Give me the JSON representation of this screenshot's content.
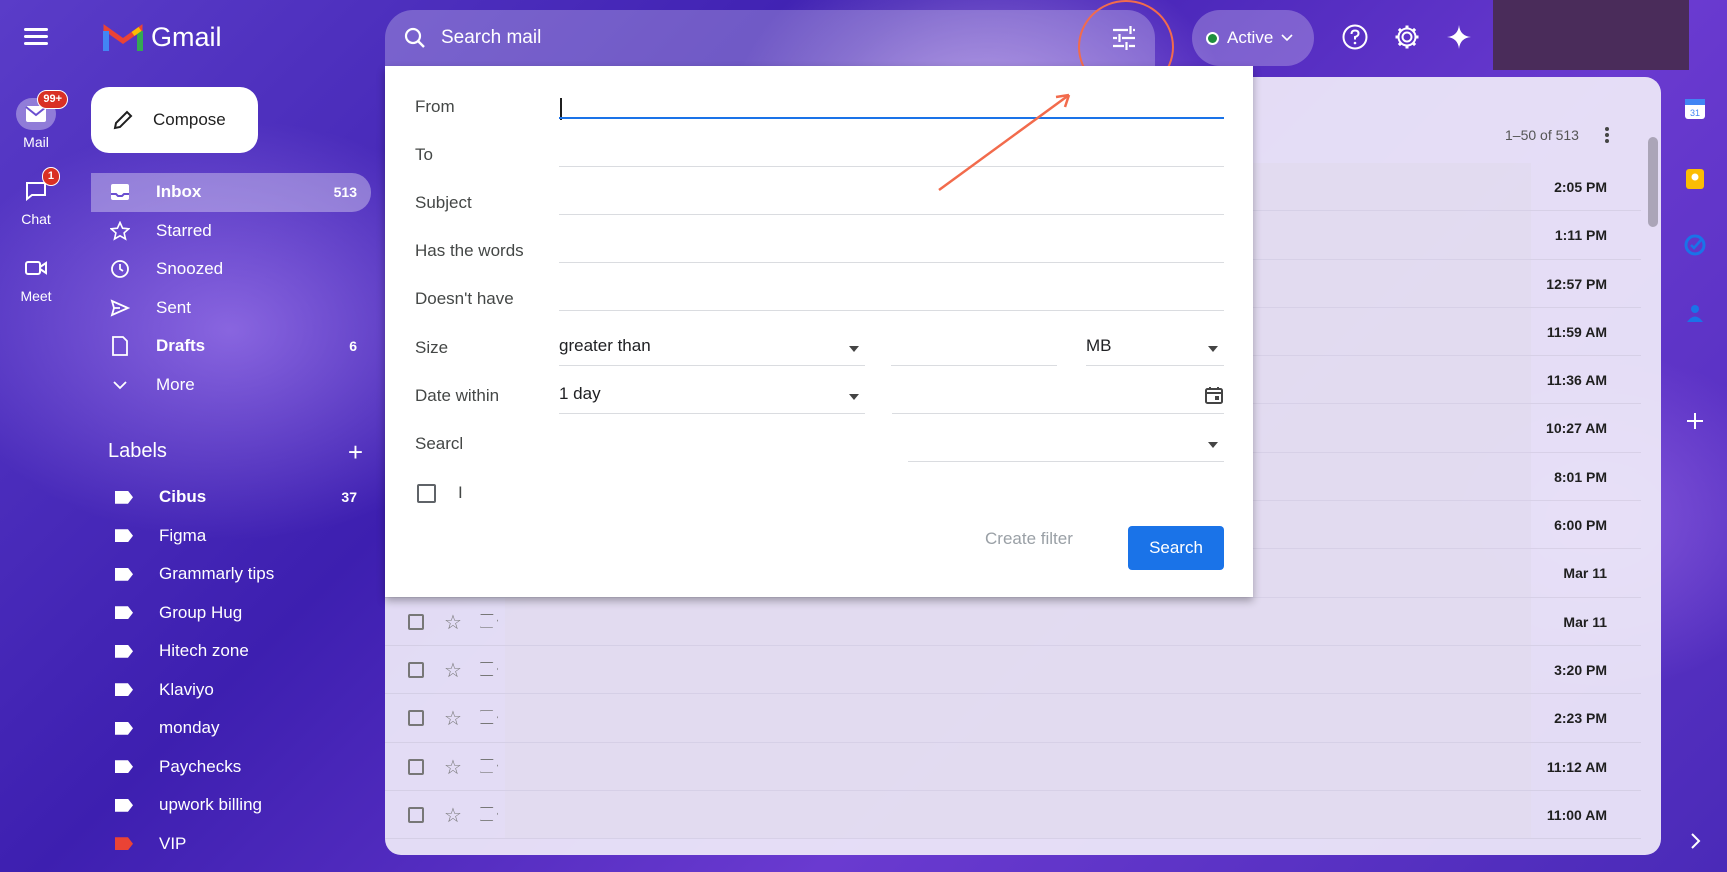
{
  "rail": {
    "items": [
      {
        "label": "Mail",
        "badge": "99+"
      },
      {
        "label": "Chat",
        "badge": "1"
      },
      {
        "label": "Meet",
        "badge": ""
      }
    ]
  },
  "logo": {
    "wordmark": "Gmail"
  },
  "compose_label": "Compose",
  "nav": [
    {
      "label": "Inbox",
      "count": "513",
      "icon": "inbox-icon"
    },
    {
      "label": "Starred",
      "count": "",
      "icon": "star-icon"
    },
    {
      "label": "Snoozed",
      "count": "",
      "icon": "clock-icon"
    },
    {
      "label": "Sent",
      "count": "",
      "icon": "send-icon"
    },
    {
      "label": "Drafts",
      "count": "6",
      "icon": "draft-icon"
    },
    {
      "label": "More",
      "count": "",
      "icon": "chevron-down-icon"
    }
  ],
  "labels": {
    "title": "Labels",
    "items": [
      {
        "label": "Cibus",
        "count": "37"
      },
      {
        "label": "Figma",
        "count": ""
      },
      {
        "label": "Grammarly tips",
        "count": ""
      },
      {
        "label": "Group Hug",
        "count": ""
      },
      {
        "label": "Hitech zone",
        "count": ""
      },
      {
        "label": "Klaviyo",
        "count": ""
      },
      {
        "label": "monday",
        "count": ""
      },
      {
        "label": "Paychecks",
        "count": ""
      },
      {
        "label": "upwork billing",
        "count": ""
      },
      {
        "label": "VIP",
        "count": ""
      }
    ]
  },
  "search": {
    "placeholder": "Search mail"
  },
  "status": {
    "label": "Active"
  },
  "pager": "1–50 of 513",
  "rows": [
    {
      "time": "2:05 PM"
    },
    {
      "time": "1:11 PM"
    },
    {
      "time": "12:57 PM"
    },
    {
      "time": "11:59 AM"
    },
    {
      "time": "11:36 AM"
    },
    {
      "time": "10:27 AM"
    },
    {
      "time": "8:01 PM"
    },
    {
      "time": "6:00 PM"
    },
    {
      "time": "Mar 11"
    },
    {
      "time": "Mar 11"
    },
    {
      "time": "3:20 PM"
    },
    {
      "time": "2:23 PM"
    },
    {
      "time": "11:12 AM"
    },
    {
      "time": "11:00 AM"
    }
  ],
  "advanced_search": {
    "from": "From",
    "to": "To",
    "subject": "Subject",
    "has_words": "Has the words",
    "doesnt_have": "Doesn't have",
    "size": "Size",
    "size_op": "greater than",
    "size_unit": "MB",
    "date_within": "Date within",
    "date_value": "1 day",
    "search_in": "Searcl",
    "checkbox_label": "I",
    "create_filter": "Create filter",
    "search_button": "Search"
  },
  "colors": {
    "accent": "#1a73e8",
    "annotation": "#f26b4c",
    "badge": "#d93025"
  }
}
